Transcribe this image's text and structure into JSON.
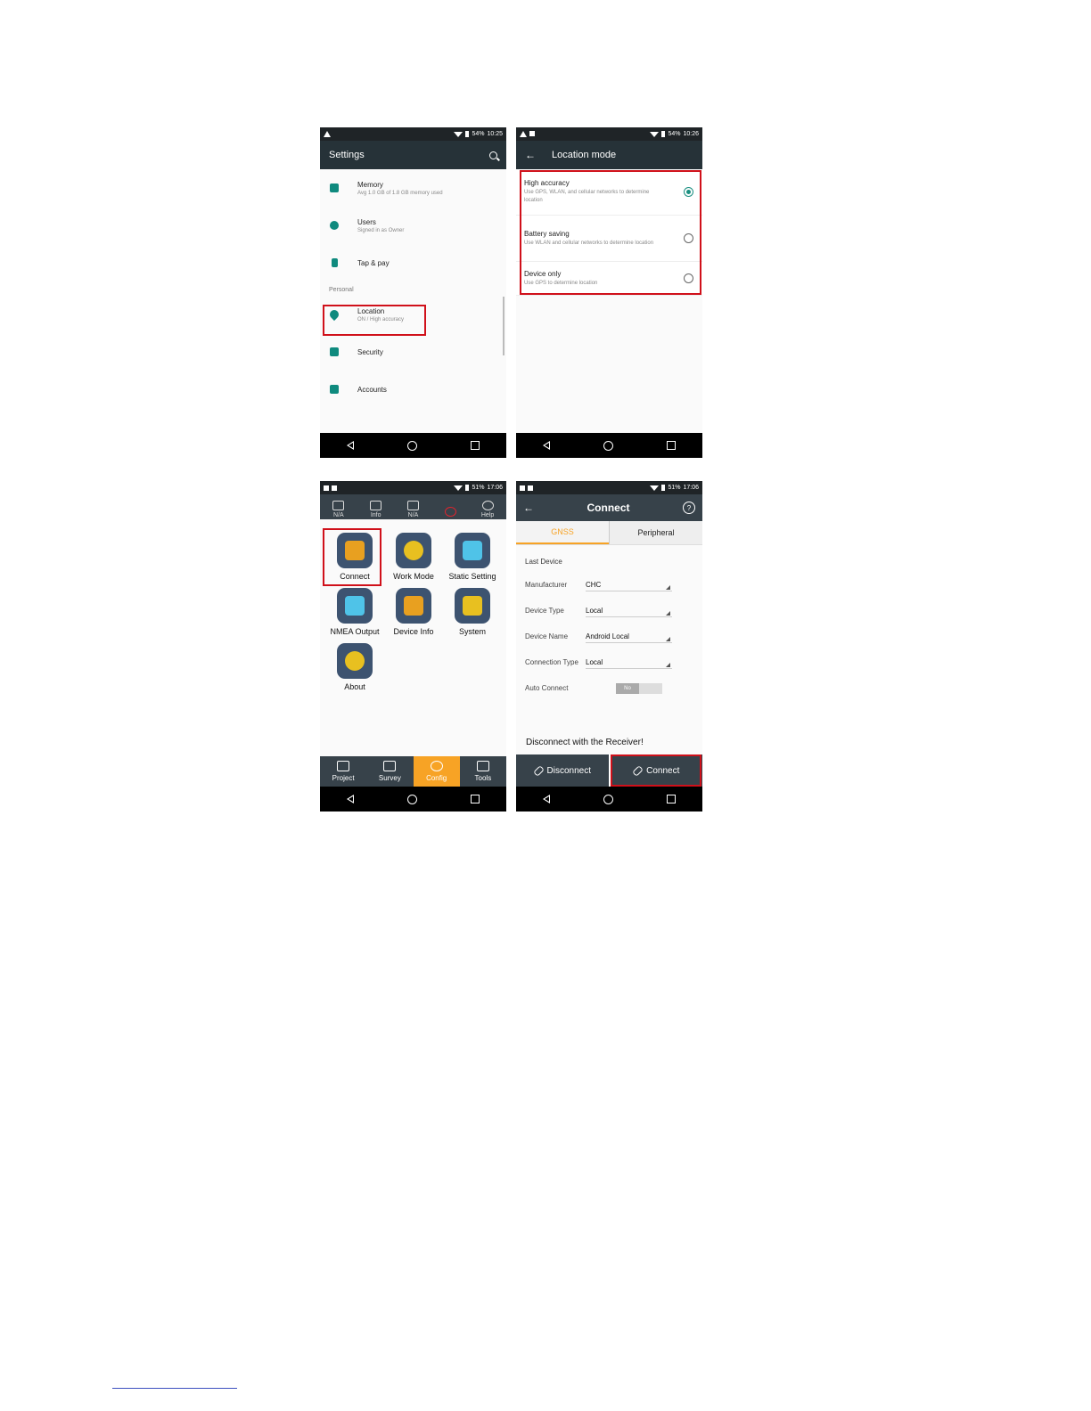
{
  "status1": {
    "battery": "54%",
    "time": "10:25"
  },
  "status2": {
    "battery": "54%",
    "time": "10:26"
  },
  "status3": {
    "battery": "51%",
    "time": "17:06"
  },
  "status4": {
    "battery": "51%",
    "time": "17:06"
  },
  "settings": {
    "title": "Settings",
    "items": [
      {
        "title": "Memory",
        "sub": "Avg 1.0 GB of 1.8 GB memory used",
        "icon": "memory-icon"
      },
      {
        "title": "Users",
        "sub": "Signed in as Owner",
        "icon": "person-icon"
      },
      {
        "title": "Tap & pay",
        "sub": "",
        "icon": "tap-pay-icon"
      }
    ],
    "section": "Personal",
    "personal": [
      {
        "title": "Location",
        "sub": "ON / High accuracy",
        "icon": "location-pin-icon"
      },
      {
        "title": "Security",
        "sub": "",
        "icon": "lock-icon"
      },
      {
        "title": "Accounts",
        "sub": "",
        "icon": "account-icon"
      }
    ]
  },
  "location_mode": {
    "title": "Location mode",
    "options": [
      {
        "title": "High accuracy",
        "sub": "Use GPS, WLAN, and cellular networks to determine location",
        "selected": true
      },
      {
        "title": "Battery saving",
        "sub": "Use WLAN and cellular networks to determine location",
        "selected": false
      },
      {
        "title": "Device only",
        "sub": "Use GPS to determine location",
        "selected": false
      }
    ]
  },
  "config": {
    "toolbar": [
      {
        "label": "N/A",
        "icon": "device-icon"
      },
      {
        "label": "Info",
        "icon": "satellite-icon"
      },
      {
        "label": "N/A",
        "icon": "settings-gear-icon"
      },
      {
        "label": "",
        "icon": "record-icon"
      },
      {
        "label": "Help",
        "icon": "help-icon"
      }
    ],
    "grid": [
      {
        "label": "Connect",
        "icon": "connect-icon",
        "color": "#e8a020"
      },
      {
        "label": "Work Mode",
        "icon": "work-mode-icon",
        "color": "#e8c020"
      },
      {
        "label": "Static Setting",
        "icon": "static-setting-icon",
        "color": "#4fc3e8"
      },
      {
        "label": "NMEA Output",
        "icon": "nmea-output-icon",
        "color": "#4fc3e8"
      },
      {
        "label": "Device Info",
        "icon": "device-info-icon",
        "color": "#e8a020"
      },
      {
        "label": "System",
        "icon": "system-icon",
        "color": "#e8c020"
      },
      {
        "label": "About",
        "icon": "about-icon",
        "color": "#e8c020"
      }
    ],
    "tabs": [
      {
        "label": "Project",
        "icon": "project-icon",
        "active": false
      },
      {
        "label": "Survey",
        "icon": "survey-icon",
        "active": false
      },
      {
        "label": "Config",
        "icon": "config-icon",
        "active": true
      },
      {
        "label": "Tools",
        "icon": "tools-icon",
        "active": false
      }
    ]
  },
  "connect": {
    "title": "Connect",
    "tab_gnss": "GNSS",
    "tab_peripheral": "Peripheral",
    "last_device": "Last Device",
    "fields": [
      {
        "label": "Manufacturer",
        "value": "CHC"
      },
      {
        "label": "Device Type",
        "value": "Local"
      },
      {
        "label": "Device Name",
        "value": "Android Local"
      },
      {
        "label": "Connection Type",
        "value": "Local"
      }
    ],
    "auto_connect_label": "Auto Connect",
    "auto_connect_value": "No",
    "message": "Disconnect with the Receiver!",
    "disconnect_label": "Disconnect",
    "connect_label": "Connect"
  },
  "colors": {
    "accent": "#f7a325",
    "teal": "#0f8a7e",
    "highlight": "#d0101a"
  }
}
